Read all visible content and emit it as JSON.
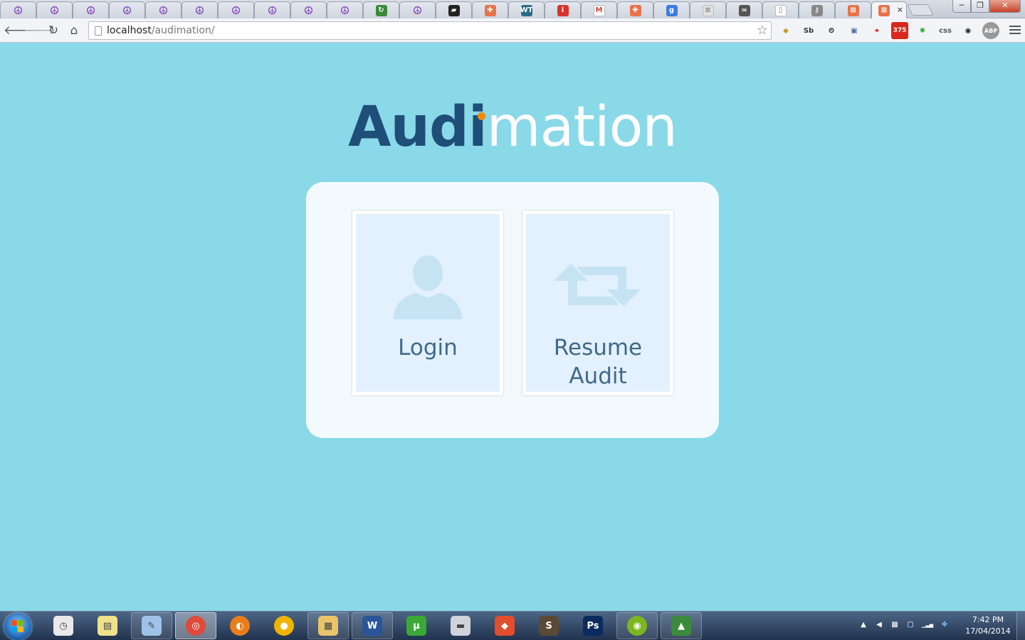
{
  "browser": {
    "url_host": "localhost",
    "url_path": "/audimation/",
    "tabs": [
      {
        "icon": "peace-icon",
        "glyph": "☮"
      },
      {
        "icon": "peace-icon",
        "glyph": "☮"
      },
      {
        "icon": "peace-icon",
        "glyph": "☮"
      },
      {
        "icon": "peace-icon",
        "glyph": "☮"
      },
      {
        "icon": "peace-icon",
        "glyph": "☮"
      },
      {
        "icon": "peace-icon",
        "glyph": "☮"
      },
      {
        "icon": "peace-icon",
        "glyph": "☮"
      },
      {
        "icon": "peace-icon",
        "glyph": "☮"
      },
      {
        "icon": "peace-icon",
        "glyph": "☮"
      },
      {
        "icon": "peace-icon",
        "glyph": "☮"
      },
      {
        "icon": "sync-icon",
        "glyph": "↻"
      },
      {
        "icon": "peace-icon",
        "glyph": "☮"
      },
      {
        "icon": "terminal-icon",
        "glyph": "▰"
      },
      {
        "icon": "plus-cross-icon",
        "glyph": "✚"
      },
      {
        "icon": "wt-icon",
        "glyph": "WT"
      },
      {
        "icon": "info-icon",
        "glyph": "i"
      },
      {
        "icon": "gmail-icon",
        "glyph": "M"
      },
      {
        "icon": "plus-cross-icon",
        "glyph": "✚"
      },
      {
        "icon": "google-icon",
        "glyph": "g"
      },
      {
        "icon": "stack-icon",
        "glyph": "≡"
      },
      {
        "icon": "cloud-icon",
        "glyph": "∞"
      },
      {
        "icon": "page-icon",
        "glyph": "▯"
      },
      {
        "icon": "key-icon",
        "glyph": "⚷"
      },
      {
        "icon": "xampp-icon",
        "glyph": "⊠"
      }
    ],
    "active_tab": {
      "icon": "xampp-icon",
      "glyph": "⊠",
      "close": "×"
    },
    "window_controls": {
      "minimize": "─",
      "maximize": "❐",
      "close": "✕"
    },
    "extensions": [
      {
        "icon": "basket-icon",
        "glyph": "◆",
        "color": "#c79a2a"
      },
      {
        "icon": "sb-icon",
        "glyph": "Sb",
        "color": "#333333"
      },
      {
        "icon": "timer-icon",
        "glyph": "⏲",
        "color": "#222222"
      },
      {
        "icon": "window-icon",
        "glyph": "▣",
        "color": "#4a6da7"
      },
      {
        "icon": "crosshair-icon",
        "glyph": "⌖",
        "color": "#cc2222"
      },
      {
        "icon": "gmail-count-icon",
        "glyph": "375",
        "color": "#d8281d"
      },
      {
        "icon": "color-wheel-icon",
        "glyph": "✺",
        "color": "#2aa52a"
      },
      {
        "icon": "css-icon",
        "glyph": "css",
        "color": "#555555"
      },
      {
        "icon": "eye-icon",
        "glyph": "◉",
        "color": "#222222"
      },
      {
        "icon": "abp-icon",
        "glyph": "ABP",
        "color": "#888888"
      }
    ]
  },
  "app": {
    "logo_part1": "Audi",
    "logo_part2": "mation",
    "colors": {
      "dark": "#1f4e79",
      "accent": "#f28a0a",
      "background": "#89d9e8"
    },
    "cards": {
      "login": {
        "label": "Login",
        "icon": "user-icon"
      },
      "resume": {
        "label_line1": "Resume",
        "label_line2": "Audit",
        "icon": "retweet-arrows-icon"
      }
    }
  },
  "taskbar": {
    "items": [
      {
        "icon": "stopwatch-icon",
        "glyph": "◷",
        "color": "#e9e9e9",
        "state": ""
      },
      {
        "icon": "sticky-notes-icon",
        "glyph": "▤",
        "color": "#f0e18a",
        "state": ""
      },
      {
        "icon": "notepad-icon",
        "glyph": "✎",
        "color": "#9fc3e8",
        "state": "open"
      },
      {
        "icon": "chrome-icon",
        "glyph": "◎",
        "color": "#e04a3a",
        "state": "active"
      },
      {
        "icon": "firefox-icon",
        "glyph": "◐",
        "color": "#e97d1c",
        "state": ""
      },
      {
        "icon": "circle-app-icon",
        "glyph": "●",
        "color": "#f0b400",
        "state": ""
      },
      {
        "icon": "explorer-icon",
        "glyph": "▦",
        "color": "#e9c46a",
        "state": "open"
      },
      {
        "icon": "word-icon",
        "glyph": "W",
        "color": "#2a5699",
        "state": "open"
      },
      {
        "icon": "utorrent-icon",
        "glyph": "µ",
        "color": "#3ba935",
        "state": ""
      },
      {
        "icon": "drive-icon",
        "glyph": "▬",
        "color": "#cfd4da",
        "state": ""
      },
      {
        "icon": "git-icon",
        "glyph": "◆",
        "color": "#e24d2b",
        "state": ""
      },
      {
        "icon": "sublime-icon",
        "glyph": "S",
        "color": "#5a4a35",
        "state": ""
      },
      {
        "icon": "photoshop-icon",
        "glyph": "Ps",
        "color": "#0b2a5e",
        "state": ""
      },
      {
        "icon": "spotify-icon",
        "glyph": "◉",
        "color": "#7bb820",
        "state": "open"
      },
      {
        "icon": "avg-icon",
        "glyph": "▲",
        "color": "#3c8b3c",
        "state": "open"
      }
    ],
    "tray": [
      {
        "icon": "tray-arrow-icon",
        "glyph": "▲"
      },
      {
        "icon": "volume-icon",
        "glyph": "◀"
      },
      {
        "icon": "network-monitor-icon",
        "glyph": "▩"
      },
      {
        "icon": "clipboard-icon",
        "glyph": "▢"
      },
      {
        "icon": "signal-icon",
        "glyph": "▁▃▅"
      },
      {
        "icon": "dropbox-icon",
        "glyph": "✥"
      }
    ],
    "time": "7:42 PM",
    "date": "17/04/2014"
  }
}
